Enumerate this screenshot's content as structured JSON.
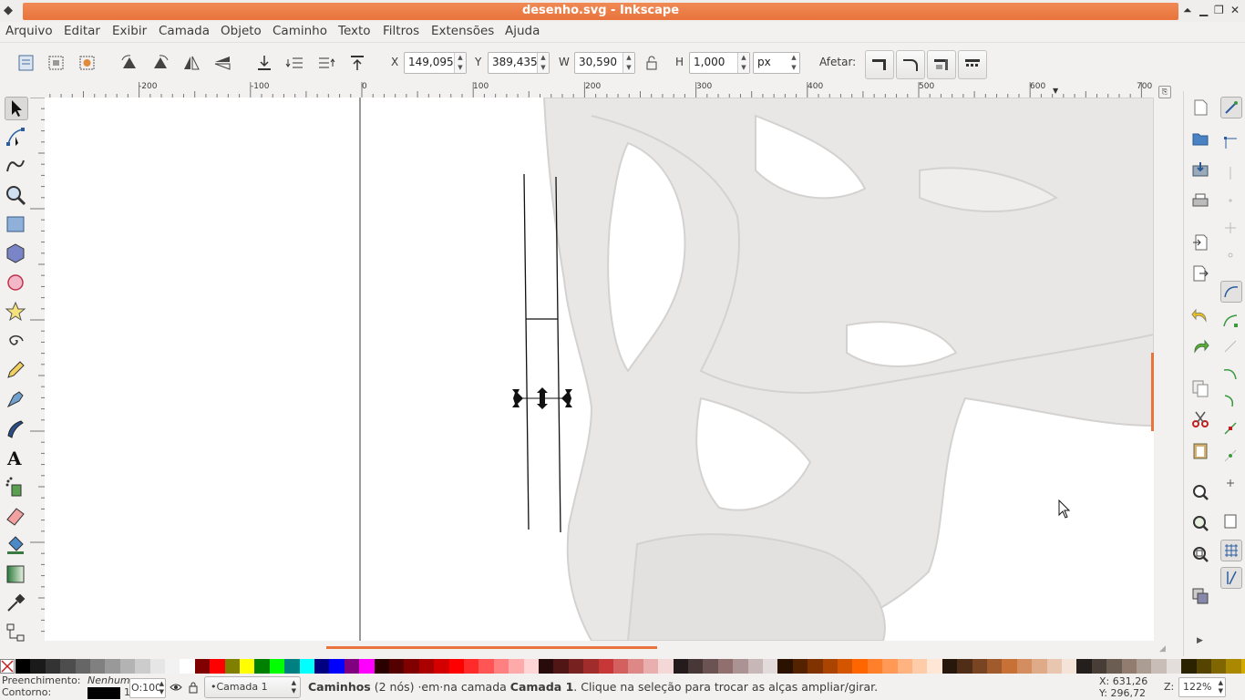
{
  "window": {
    "title": "desenho.svg - Inkscape"
  },
  "menu": [
    "Arquivo",
    "Editar",
    "Exibir",
    "Camada",
    "Objeto",
    "Caminho",
    "Texto",
    "Filtros",
    "Extensões",
    "Ajuda"
  ],
  "toolbar": {
    "x_label": "X",
    "x_value": "149,095",
    "y_label": "Y",
    "y_value": "389,435",
    "w_label": "W",
    "w_value": "30,590",
    "h_label": "H",
    "h_value": "1,000",
    "unit": "px",
    "affect_label": "Afetar:"
  },
  "ruler": {
    "labels": [
      "-200",
      "-100",
      "0",
      "100",
      "200",
      "300",
      "400",
      "500",
      "600",
      "700"
    ]
  },
  "status": {
    "fill_label": "Preenchimento:",
    "fill_value": "Nenhum",
    "stroke_label": "Contorno:",
    "stroke_width": "1",
    "opacity": "O:100",
    "layer": "•Camada 1",
    "message_bold1": "Caminhos",
    "message_part1": " (2 nós) ·em·na camada ",
    "message_bold2": "Camada 1",
    "message_part2": ". Clique na seleção para trocar as alças ampliar/girar.",
    "x_coord": "X: 631,26",
    "y_coord": "Y: 296,72",
    "zoom_label": "Z:",
    "zoom_value": "122%"
  },
  "colors": {
    "titlebar_accent": "#e9733c",
    "canvas": "#ffffff",
    "skull_tint": "#e9e8e7"
  },
  "palette": [
    "#000000",
    "#1a1a1a",
    "#333333",
    "#4d4d4d",
    "#666666",
    "#808080",
    "#999999",
    "#b3b3b3",
    "#cccccc",
    "#e6e6e6",
    "#f2f2f2",
    "#ffffff",
    "#800000",
    "#ff0000",
    "#808000",
    "#ffff00",
    "#008000",
    "#00ff00",
    "#008080",
    "#00ffff",
    "#000080",
    "#0000ff",
    "#800080",
    "#ff00ff",
    "#2b0000",
    "#550000",
    "#800000",
    "#aa0000",
    "#d40000",
    "#ff0000",
    "#ff2a2a",
    "#ff5555",
    "#ff8080",
    "#ffaaaa",
    "#ffd5d5",
    "#280b0b",
    "#501616",
    "#782121",
    "#a02c2c",
    "#c83737",
    "#d35f5f",
    "#de8787",
    "#e9afaf",
    "#f4d7d7",
    "#241c1c",
    "#483737",
    "#6c5353",
    "#916f6f",
    "#ac9393",
    "#c8b7b7",
    "#e3dbdb",
    "#2b1100",
    "#552200",
    "#803300",
    "#aa4400",
    "#d45500",
    "#ff6600",
    "#ff7f2a",
    "#ff9955",
    "#ffb380",
    "#ffccaa",
    "#ffe6d5",
    "#28170b",
    "#502d16",
    "#784421",
    "#a05a2c",
    "#c87137",
    "#d38d5f",
    "#deaa87",
    "#e9c6af",
    "#f4e3d7",
    "#241f1c",
    "#483e37",
    "#6c5d53",
    "#917c6f",
    "#ac9d93",
    "#c8beb7",
    "#e3dedb",
    "#2b2200",
    "#554400",
    "#806600",
    "#aa8800",
    "#d4aa00"
  ],
  "icons": {
    "tools": [
      "selector-icon",
      "node-editor-icon",
      "tweak-icon",
      "zoom-icon",
      "rectangle-icon",
      "3d-box-icon",
      "ellipse-icon",
      "star-icon",
      "spiral-icon",
      "pencil-icon",
      "pen-icon",
      "calligraphy-icon",
      "text-icon",
      "spray-icon",
      "eraser-icon",
      "paint-bucket-icon",
      "gradient-icon",
      "dropper-icon",
      "connector-icon"
    ]
  }
}
